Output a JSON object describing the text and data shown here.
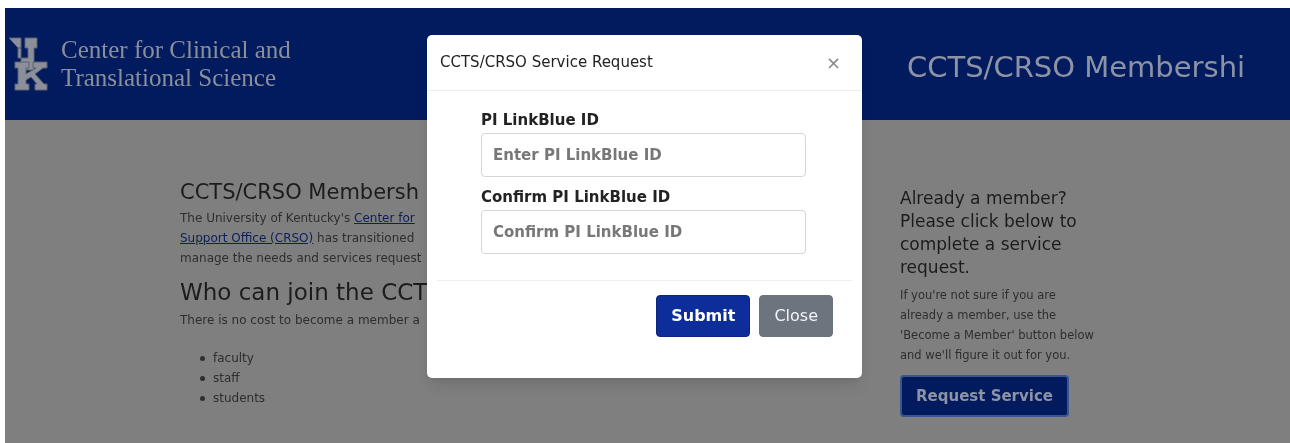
{
  "header": {
    "logo_lines": [
      "Center for Clinical and",
      "Translational Science"
    ],
    "banner_title": "CCTS/CRSO Membershi"
  },
  "main": {
    "heading": "CCTS/CRSO Membersh",
    "intro_lines": [
      [
        {
          "text": "The University of Kentucky's ",
          "link": false
        },
        {
          "text": "Center for",
          "link": true
        }
      ],
      [
        {
          "text": "Support Office (CRSO)",
          "link": true
        },
        {
          "text": " has transitioned",
          "link": false
        }
      ],
      [
        {
          "text": "manage the needs and services request",
          "link": false
        }
      ]
    ],
    "subheading": "Who can join the CCT",
    "cost_text": "There is no cost to become a member a",
    "eligible": [
      "faculty",
      "staff",
      "students"
    ]
  },
  "aside": {
    "heading": "Already a member? Please click below to complete a service request.",
    "text": "If you're not sure if you are already a member, use the 'Become a Member' button below and we'll figure it out for you.",
    "button": "Request Service"
  },
  "modal": {
    "title": "CCTS/CRSO Service Request",
    "close_icon": "×",
    "fields": [
      {
        "label": "PI LinkBlue ID",
        "placeholder": "Enter PI LinkBlue ID"
      },
      {
        "label": "Confirm PI LinkBlue ID",
        "placeholder": "Confirm PI LinkBlue ID"
      }
    ],
    "buttons": [
      {
        "label": "Submit",
        "kind": "primary"
      },
      {
        "label": "Close",
        "kind": "secondary"
      }
    ]
  }
}
